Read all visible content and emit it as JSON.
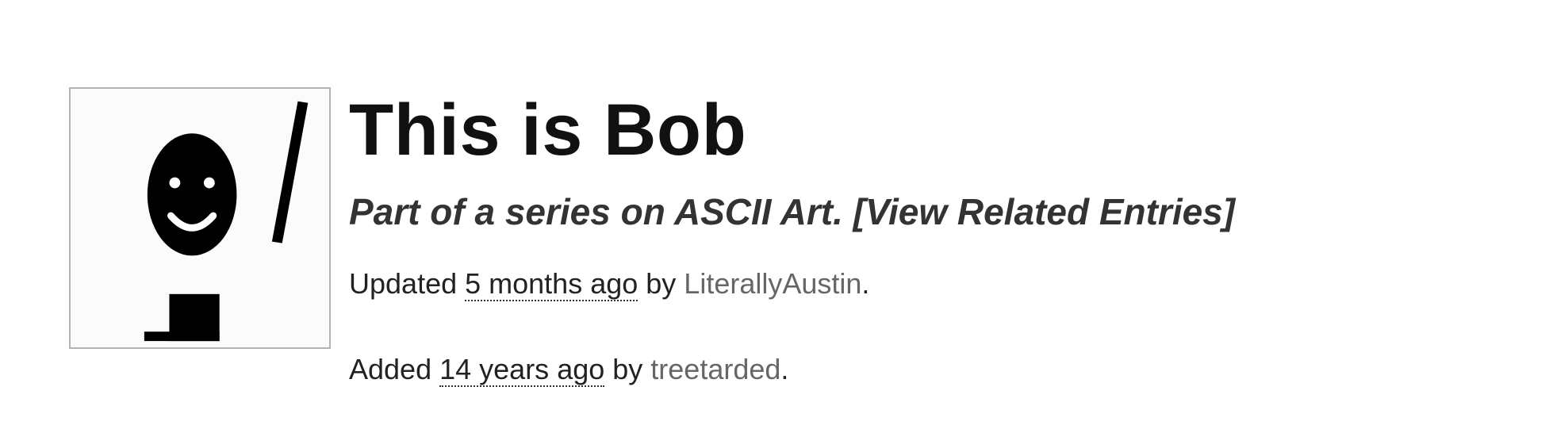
{
  "entry": {
    "title": "This is Bob",
    "series_prefix": "Part of a series on ",
    "series_name": "ASCII Art",
    "series_suffix": ". ",
    "related_link": "[View Related Entries]",
    "thumbnail_icon": "ascii-bob-image"
  },
  "updated": {
    "prefix": "Updated ",
    "time": "5 months ago",
    "by": " by ",
    "user": "LiterallyAustin",
    "end": "."
  },
  "added": {
    "prefix": "Added ",
    "time": "14 years ago",
    "by": " by ",
    "user": "treetarded",
    "end": "."
  }
}
